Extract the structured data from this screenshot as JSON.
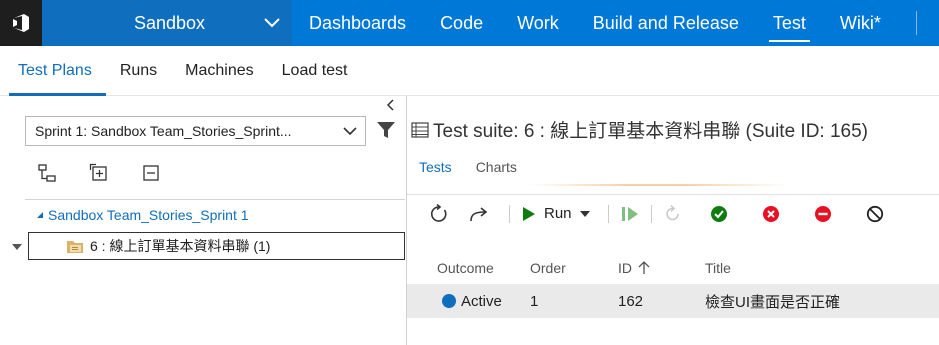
{
  "topbar": {
    "project": "Sandbox",
    "hubs": [
      {
        "label": "Dashboards"
      },
      {
        "label": "Code"
      },
      {
        "label": "Work"
      },
      {
        "label": "Build and Release"
      },
      {
        "label": "Test"
      },
      {
        "label": "Wiki*"
      }
    ],
    "selected_hub": "Test"
  },
  "subnav": {
    "tabs": [
      {
        "label": "Test Plans"
      },
      {
        "label": "Runs"
      },
      {
        "label": "Machines"
      },
      {
        "label": "Load test"
      }
    ],
    "selected": "Test Plans"
  },
  "left": {
    "plan_selector": "Sprint 1: Sandbox Team_Stories_Sprint...",
    "root_node": "Sandbox Team_Stories_Sprint 1",
    "suite_node": "6 : 線上訂單基本資料串聯 (1)"
  },
  "right": {
    "suite_title": "Test suite: 6 : 線上訂單基本資料串聯 (Suite ID: 165)",
    "tabs": [
      {
        "label": "Tests"
      },
      {
        "label": "Charts"
      }
    ],
    "selected_tab": "Tests",
    "run_label": "Run",
    "grid": {
      "columns": [
        "Outcome",
        "Order",
        "ID",
        "Title"
      ],
      "rows": [
        {
          "outcome": "Active",
          "order": "1",
          "id": "162",
          "title": "檢查UI畫面是否正確"
        }
      ]
    }
  },
  "colors": {
    "accent": "#0078d7",
    "accent_dark": "#106ebe",
    "logo_bg": "#1e1e1e",
    "pass": "#107c10",
    "fail": "#e81123"
  }
}
